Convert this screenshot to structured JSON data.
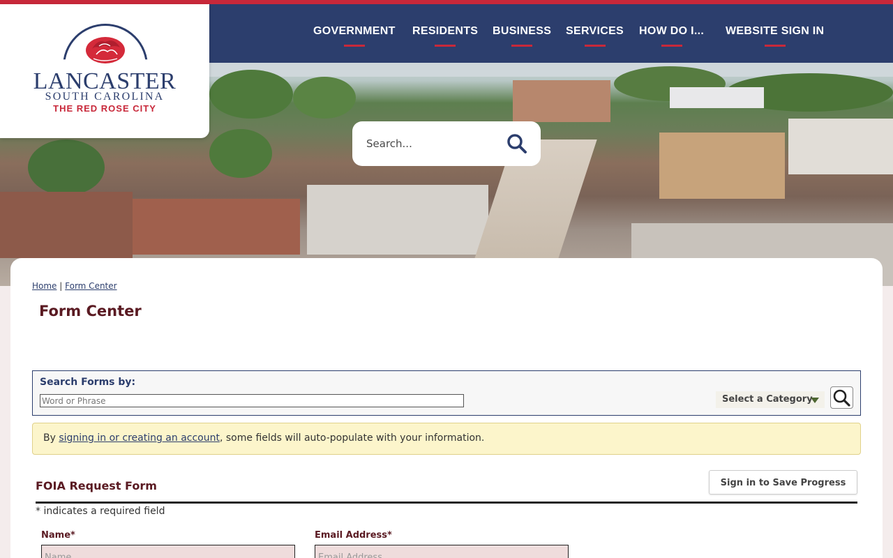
{
  "header": {
    "logo": {
      "title": "LANCASTER",
      "subtitle": "SOUTH CAROLINA",
      "tagline": "THE RED ROSE CITY"
    },
    "nav": [
      {
        "label": "GOVERNMENT"
      },
      {
        "label": "RESIDENTS"
      },
      {
        "label": "BUSINESS"
      },
      {
        "label": "SERVICES"
      },
      {
        "label": "HOW DO I..."
      },
      {
        "label": "WEBSITE SIGN IN"
      }
    ],
    "search": {
      "placeholder": "Search...",
      "icon": "search-icon"
    }
  },
  "breadcrumb": {
    "home": "Home",
    "separator": "|",
    "current": "Form Center"
  },
  "page_title": "Form Center",
  "search_forms": {
    "label": "Search Forms by:",
    "placeholder": "Word or Phrase",
    "category_label": "Select a Category",
    "icon": "search-icon"
  },
  "notice": {
    "prefix": "By ",
    "link": "signing in or creating an account",
    "suffix": ", some fields will auto-populate with your information."
  },
  "form": {
    "title": "FOIA Request Form",
    "save_button": "Sign in to Save Progress",
    "required_note": "* indicates a required field",
    "fields": [
      {
        "label": "Name*",
        "placeholder": "Name"
      },
      {
        "label": "Email Address*",
        "placeholder": "Email Address"
      }
    ]
  },
  "colors": {
    "nav_bg": "#2c3e6d",
    "accent_red": "#c8283a",
    "title_maroon": "#5a1a22",
    "notice_bg": "#fcf5cb"
  }
}
